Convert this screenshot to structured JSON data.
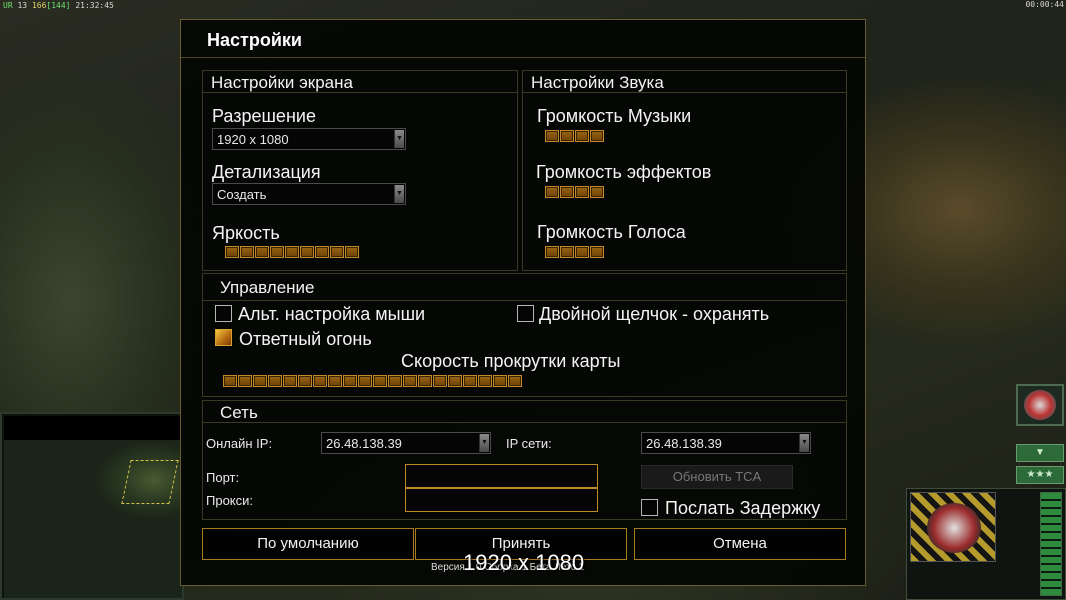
{
  "hud": {
    "top_left_prefix": "UR",
    "top_left_num1": "13",
    "top_left_num2": "166",
    "top_left_num3": "[144]",
    "top_left_time": "21:32:45",
    "top_right_time": "00:00:44"
  },
  "side": {
    "arrow_btn": "▼",
    "stars_btn": "★★★"
  },
  "dialog": {
    "title": "Настройки",
    "screen": {
      "header": "Настройки экрана",
      "resolution_label": "Разрешение",
      "resolution_value": "1920 x 1080",
      "detail_label": "Детализация",
      "detail_value": "Создать",
      "brightness_label": "Яркость",
      "brightness_segments": 9
    },
    "sound": {
      "header": "Настройки Звука",
      "music_label": "Громкость Музыки",
      "music_segments": 4,
      "effects_label": "Громкость эффектов",
      "effects_segments": 4,
      "voice_label": "Громкость Голоса",
      "voice_segments": 4
    },
    "control": {
      "header": "Управление",
      "alt_mouse_label": "Альт. настройка мыши",
      "alt_mouse_checked": false,
      "double_click_label": "Двойной щелчок - охранять",
      "double_click_checked": false,
      "return_fire_label": "Ответный огонь",
      "return_fire_checked": true,
      "scroll_speed_label": "Скорость прокрутки карты",
      "scroll_speed_segments": 20
    },
    "network": {
      "header": "Сеть",
      "online_ip_label": "Онлайн IP:",
      "online_ip_value": "26.48.138.39",
      "net_ip_label": "IP сети:",
      "net_ip_value": "26.48.138.39",
      "port_label": "Порт:",
      "proxy_label": "Прокси:",
      "update_tca_label": "Обновить TCA",
      "send_delay_label": "Послать Задержку",
      "send_delay_checked": false
    },
    "buttons": {
      "default": "По умолчанию",
      "accept": "Принять",
      "cancel": "Отмена"
    },
    "version": "Версия 1.0 Сборка 1 Бета Лето 1",
    "overlay_resolution": "1920 x 1080"
  }
}
